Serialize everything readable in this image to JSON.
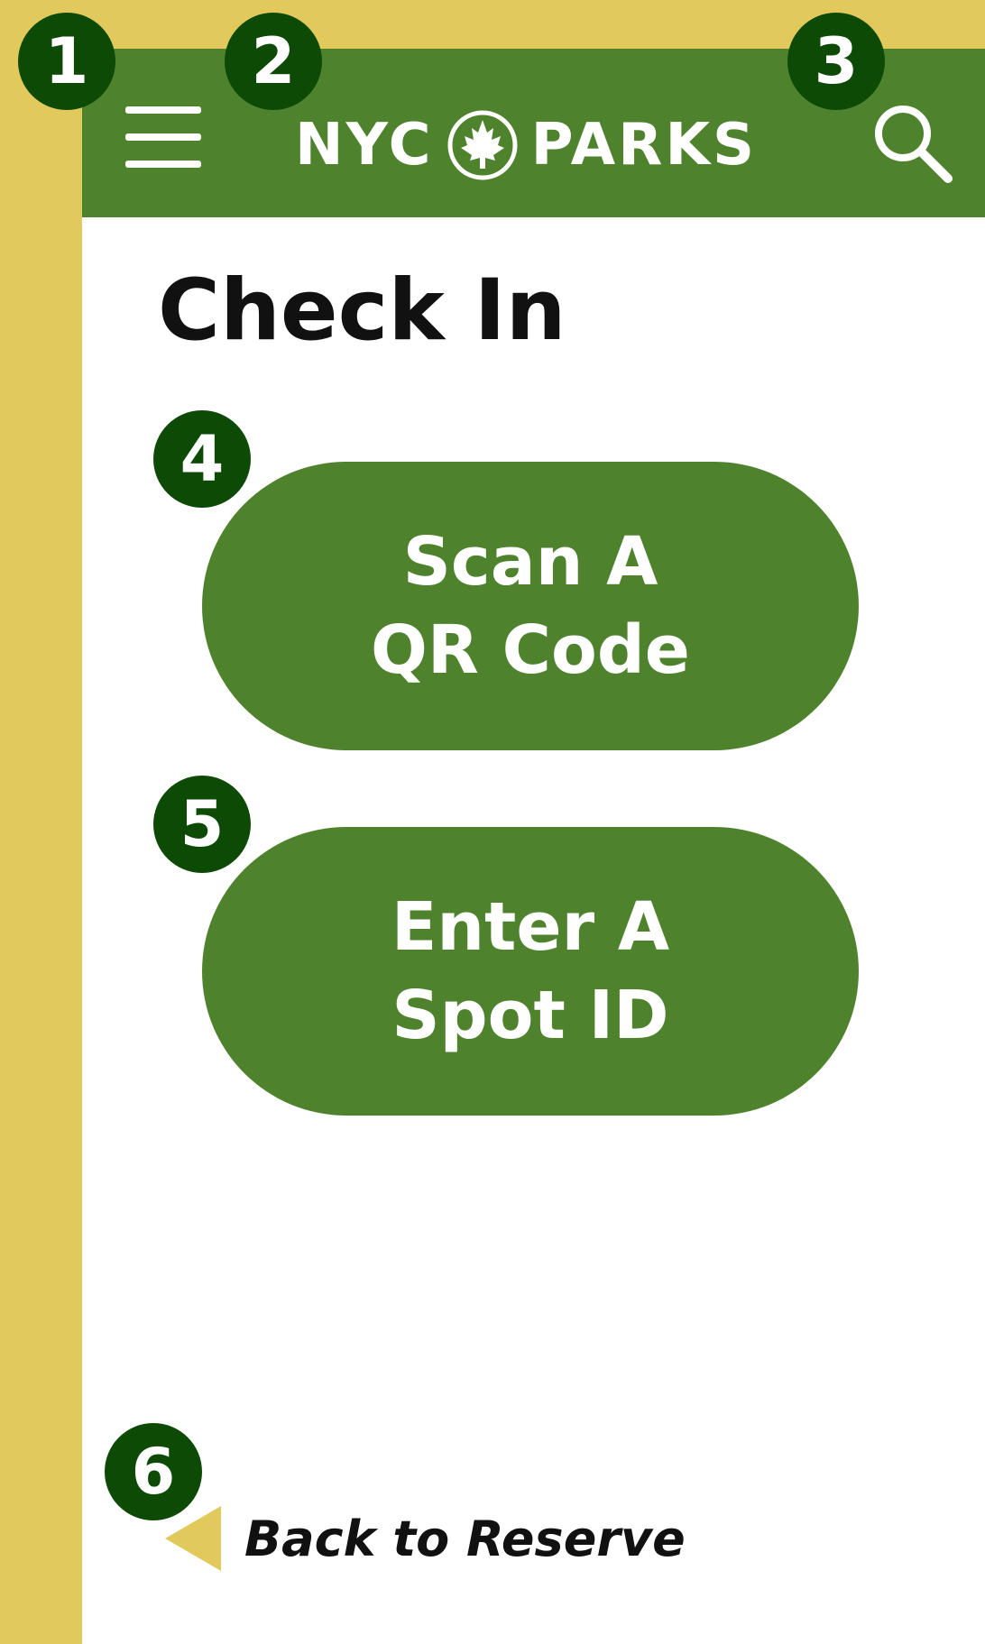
{
  "app": {
    "logo_left": "NYC",
    "logo_right": "PARKS",
    "icons": {
      "menu": "hamburger-menu-icon",
      "logo": "maple-leaf-icon",
      "search": "search-icon",
      "back": "triangle-left-icon"
    }
  },
  "page": {
    "title": "Check In"
  },
  "buttons": {
    "scan": {
      "line1": "Scan A",
      "line2": "QR Code"
    },
    "spot": {
      "line1": "Enter A",
      "line2": "Spot ID"
    }
  },
  "footer": {
    "back_label": "Back to Reserve"
  },
  "annotations": [
    "1",
    "2",
    "3",
    "4",
    "5",
    "6"
  ],
  "colors": {
    "frame_yellow": "#e2c95c",
    "header_green": "#4f822d",
    "button_green": "#4f822d",
    "badge_green": "#0d4a06",
    "back_arrow": "#e2c95c"
  }
}
